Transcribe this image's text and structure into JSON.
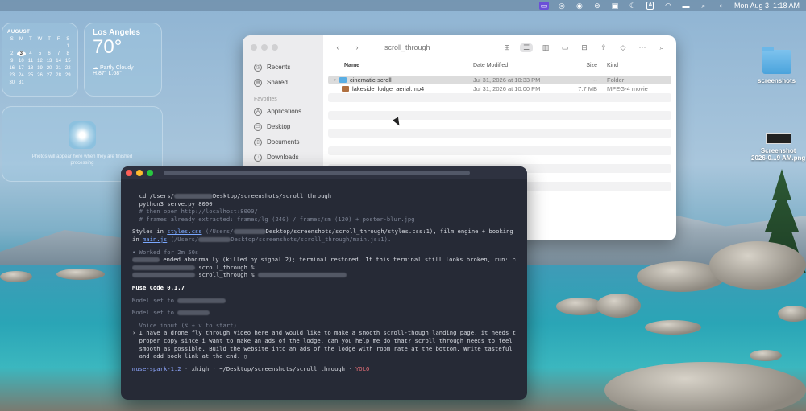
{
  "menubar": {
    "clock": "Mon Aug 3  1:18 AM",
    "input_letter": "A"
  },
  "calendar": {
    "month": "AUGUST",
    "weekdays": [
      "S",
      "M",
      "T",
      "W",
      "T",
      "F",
      "S"
    ],
    "days": [
      "",
      "",
      "",
      "",
      "",
      "",
      "1",
      "2",
      "3",
      "4",
      "5",
      "6",
      "7",
      "8",
      "9",
      "10",
      "11",
      "12",
      "13",
      "14",
      "15",
      "16",
      "17",
      "18",
      "19",
      "20",
      "21",
      "22",
      "23",
      "24",
      "25",
      "26",
      "27",
      "28",
      "29",
      "30",
      "31"
    ],
    "today": "3"
  },
  "weather": {
    "city": "Los Angeles",
    "temp": "70°",
    "condition": "Partly Cloudy",
    "hilo": "H:87° L:68°"
  },
  "photos_widget": {
    "message": "Photos will appear here when they are finished processing"
  },
  "desktop": {
    "folder_label": "screenshots",
    "screenshot_label_1": "Screenshot",
    "screenshot_label_2": "2026-0...9 AM.png"
  },
  "finder": {
    "title": "scroll_through",
    "sidebar": {
      "recents": "Recents",
      "shared": "Shared",
      "favorites_header": "Favorites",
      "applications": "Applications",
      "desktop": "Desktop",
      "documents": "Documents",
      "downloads": "Downloads"
    },
    "columns": {
      "name": "Name",
      "date": "Date Modified",
      "size": "Size",
      "kind": "Kind"
    },
    "rows": [
      {
        "name": "cinematic-scroll",
        "date": "Jul 31, 2026 at 10:33 PM",
        "size": "--",
        "kind": "Folder"
      },
      {
        "name": "lakeside_lodge_aerial.mp4",
        "date": "Jul 31, 2026 at 10:00 PM",
        "size": "7.7 MB",
        "kind": "MPEG-4 movie"
      }
    ]
  },
  "terminal": {
    "l1": "cd /Users/",
    "l1b": "Desktop/screenshots/scroll_through",
    "l2": "python3 serve.py 8000",
    "l3": "# then open http://localhost:8000/",
    "l4": "# frames already extracted: frames/lg (240) / frames/sm (120) + poster-blur.jpg",
    "l5a": "Styles in ",
    "l5link": "styles.css",
    "l5b": " (/Users/",
    "l5c": "Desktop/screenshots/scroll_through/styles.css:1), film engine + booking logic",
    "l6a": "in ",
    "l6link": "main.js",
    "l6b": " (/Users/",
    "l6c": "Desktop/screenshots/scroll_through/main.js:1).",
    "l7": "• Worked for 2m 50s",
    "l8": "ended abnormally (killed by signal 2); terminal restored. If this terminal still looks broken, run: reset",
    "l9": "scroll_through %",
    "l10": "scroll_through %",
    "l11": "Muse Code 0.1.7",
    "l12": "Model set to",
    "l13": "Model set to",
    "l14": "  Voice input (⌥ + v to start)",
    "p1": "› I have a drone fly through video here and would like to make a smooth scroll-though landing page, it needs to have",
    "p2": "  proper copy since i want to make an ads of the lodge, can you help me do that? scroll through needs to feel as",
    "p3": "  smooth as possible. Build the website into an ads of the lodge with room rate at the bottom. Write tasteful copies",
    "p4": "  and add book link at the end. ▯",
    "status_model": "muse-spark-1.2",
    "status_sep1": " · ",
    "status_effort": "xhigh",
    "status_sep2": " · ",
    "status_path": "~/Desktop/screenshots/scroll_through",
    "status_sep3": " · ",
    "status_mode": "YOLO"
  }
}
